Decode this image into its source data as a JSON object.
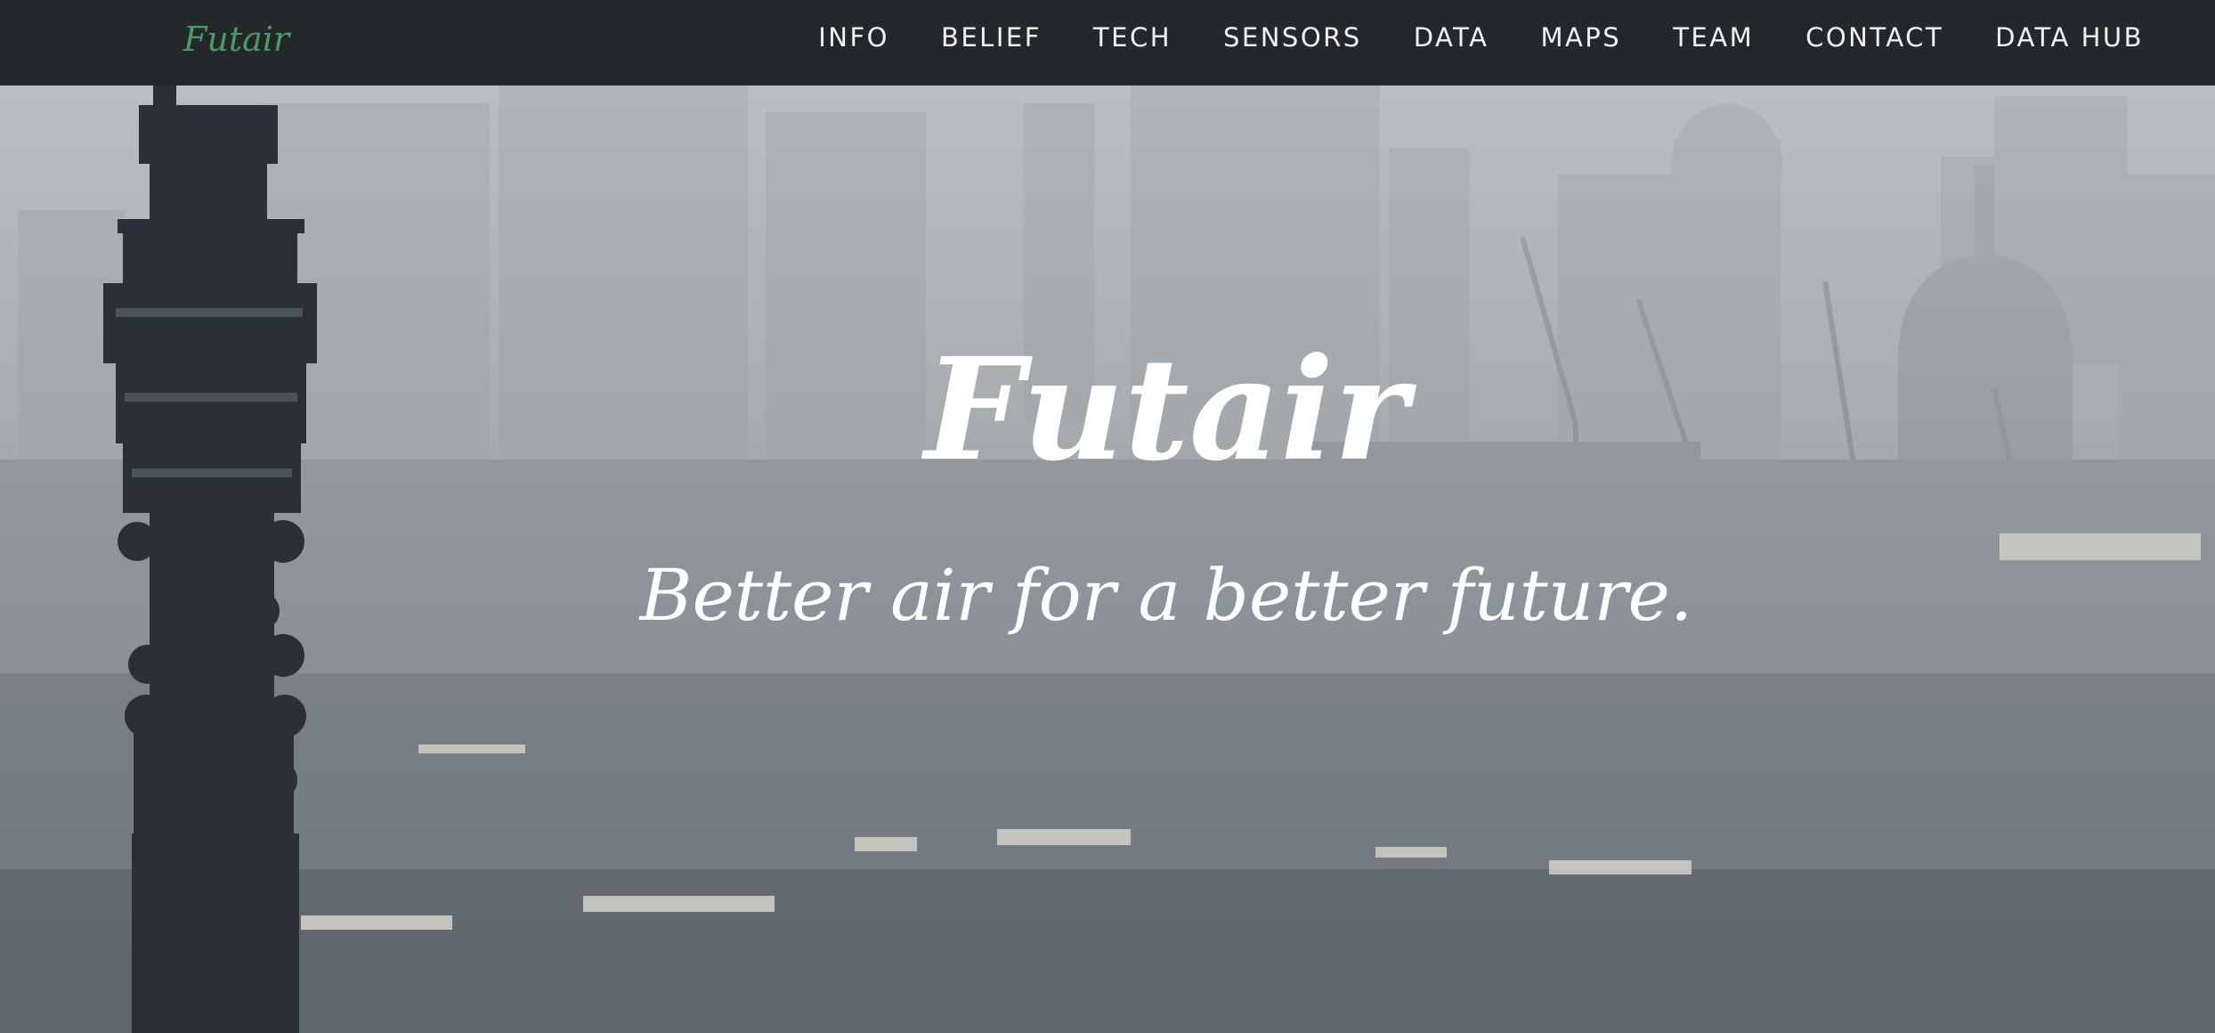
{
  "navbar": {
    "brand": "Futair",
    "links": [
      {
        "label": "INFO"
      },
      {
        "label": "BELIEF"
      },
      {
        "label": "TECH"
      },
      {
        "label": "SENSORS"
      },
      {
        "label": "DATA"
      },
      {
        "label": "MAPS"
      },
      {
        "label": "TEAM"
      },
      {
        "label": "CONTACT"
      },
      {
        "label": "DATA HUB"
      }
    ]
  },
  "hero": {
    "title": "Futair",
    "subtitle": "Better air for a better future."
  },
  "colors": {
    "navbar_background": "#24282b",
    "brand": "#4a9a68",
    "nav_text": "#f2f2f2",
    "hero_text": "#ffffff",
    "smog_haze": "#9ea3a7"
  }
}
